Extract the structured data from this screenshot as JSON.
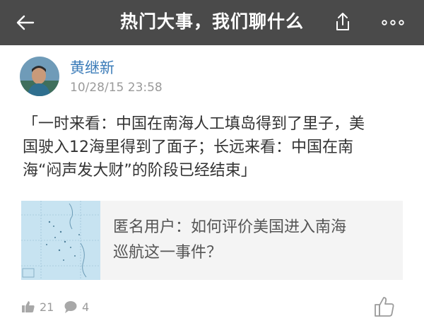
{
  "header": {
    "title": "热门大事，我们聊什么",
    "back_icon": "arrow-left-icon",
    "share_icon": "share-icon",
    "more_icon": "more-dots-icon"
  },
  "post": {
    "author": "黄继新",
    "timestamp": "10/28/15 23:58",
    "lines": [
      "「一时来看：中国在南海人工填岛得到了里子，美",
      "国驶入12海里得到了面子；长远来看：中国在南",
      "海“闷声发大财”的阶段已经结束」"
    ]
  },
  "linked_answer": {
    "lines": [
      "匿名用户：如何评价美国进入南海",
      "巡航这一事件？"
    ]
  },
  "footer": {
    "likes": "21",
    "comments": "4"
  },
  "colors": {
    "header_bg": "#4a4a4a",
    "author": "#3a7bb8",
    "card_bg": "#f4f4f4"
  }
}
